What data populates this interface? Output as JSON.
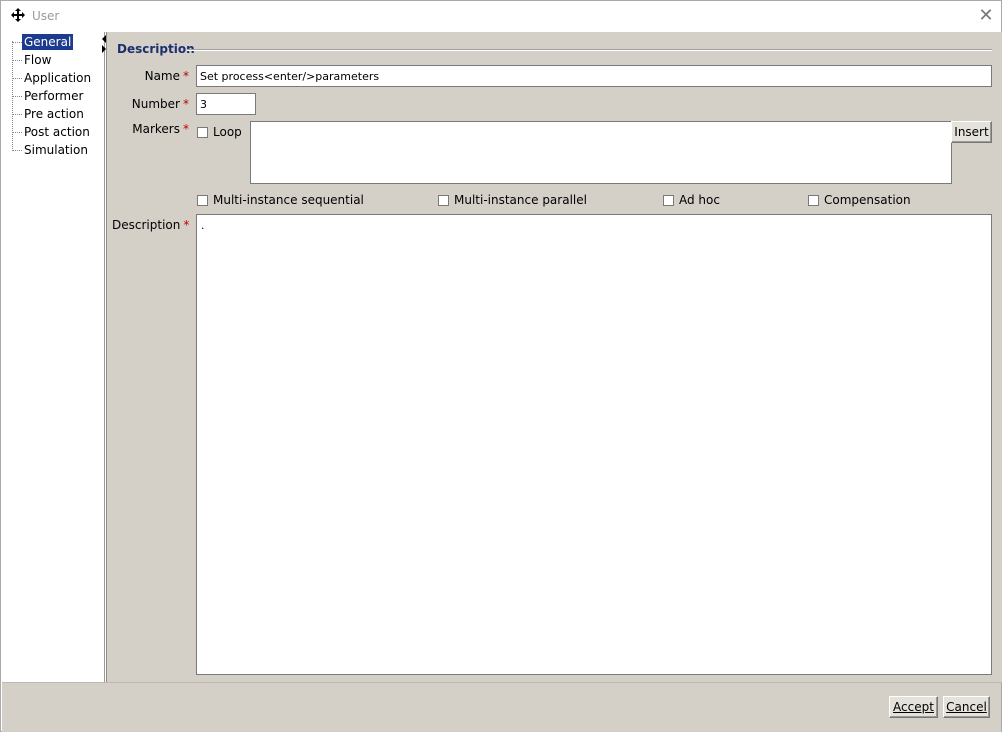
{
  "window": {
    "title": "User"
  },
  "tree": {
    "items": [
      {
        "label": "General",
        "selected": true
      },
      {
        "label": "Flow"
      },
      {
        "label": "Application"
      },
      {
        "label": "Performer"
      },
      {
        "label": "Pre action"
      },
      {
        "label": "Post action"
      },
      {
        "label": "Simulation"
      }
    ]
  },
  "form": {
    "section_title": "Description",
    "name_label": "Name",
    "name_value": "Set process<enter/>parameters",
    "number_label": "Number",
    "number_value": "3",
    "markers_label": "Markers",
    "loop_label": "Loop",
    "insert_button": "Insert",
    "marker_checkboxes": [
      "Multi-instance sequential",
      "Multi-instance parallel",
      "Ad hoc",
      "Compensation"
    ],
    "description_label": "Description",
    "description_value": ".",
    "required_mark": "*"
  },
  "footer": {
    "accept_label": "Accept",
    "cancel_label": "Cancel"
  }
}
